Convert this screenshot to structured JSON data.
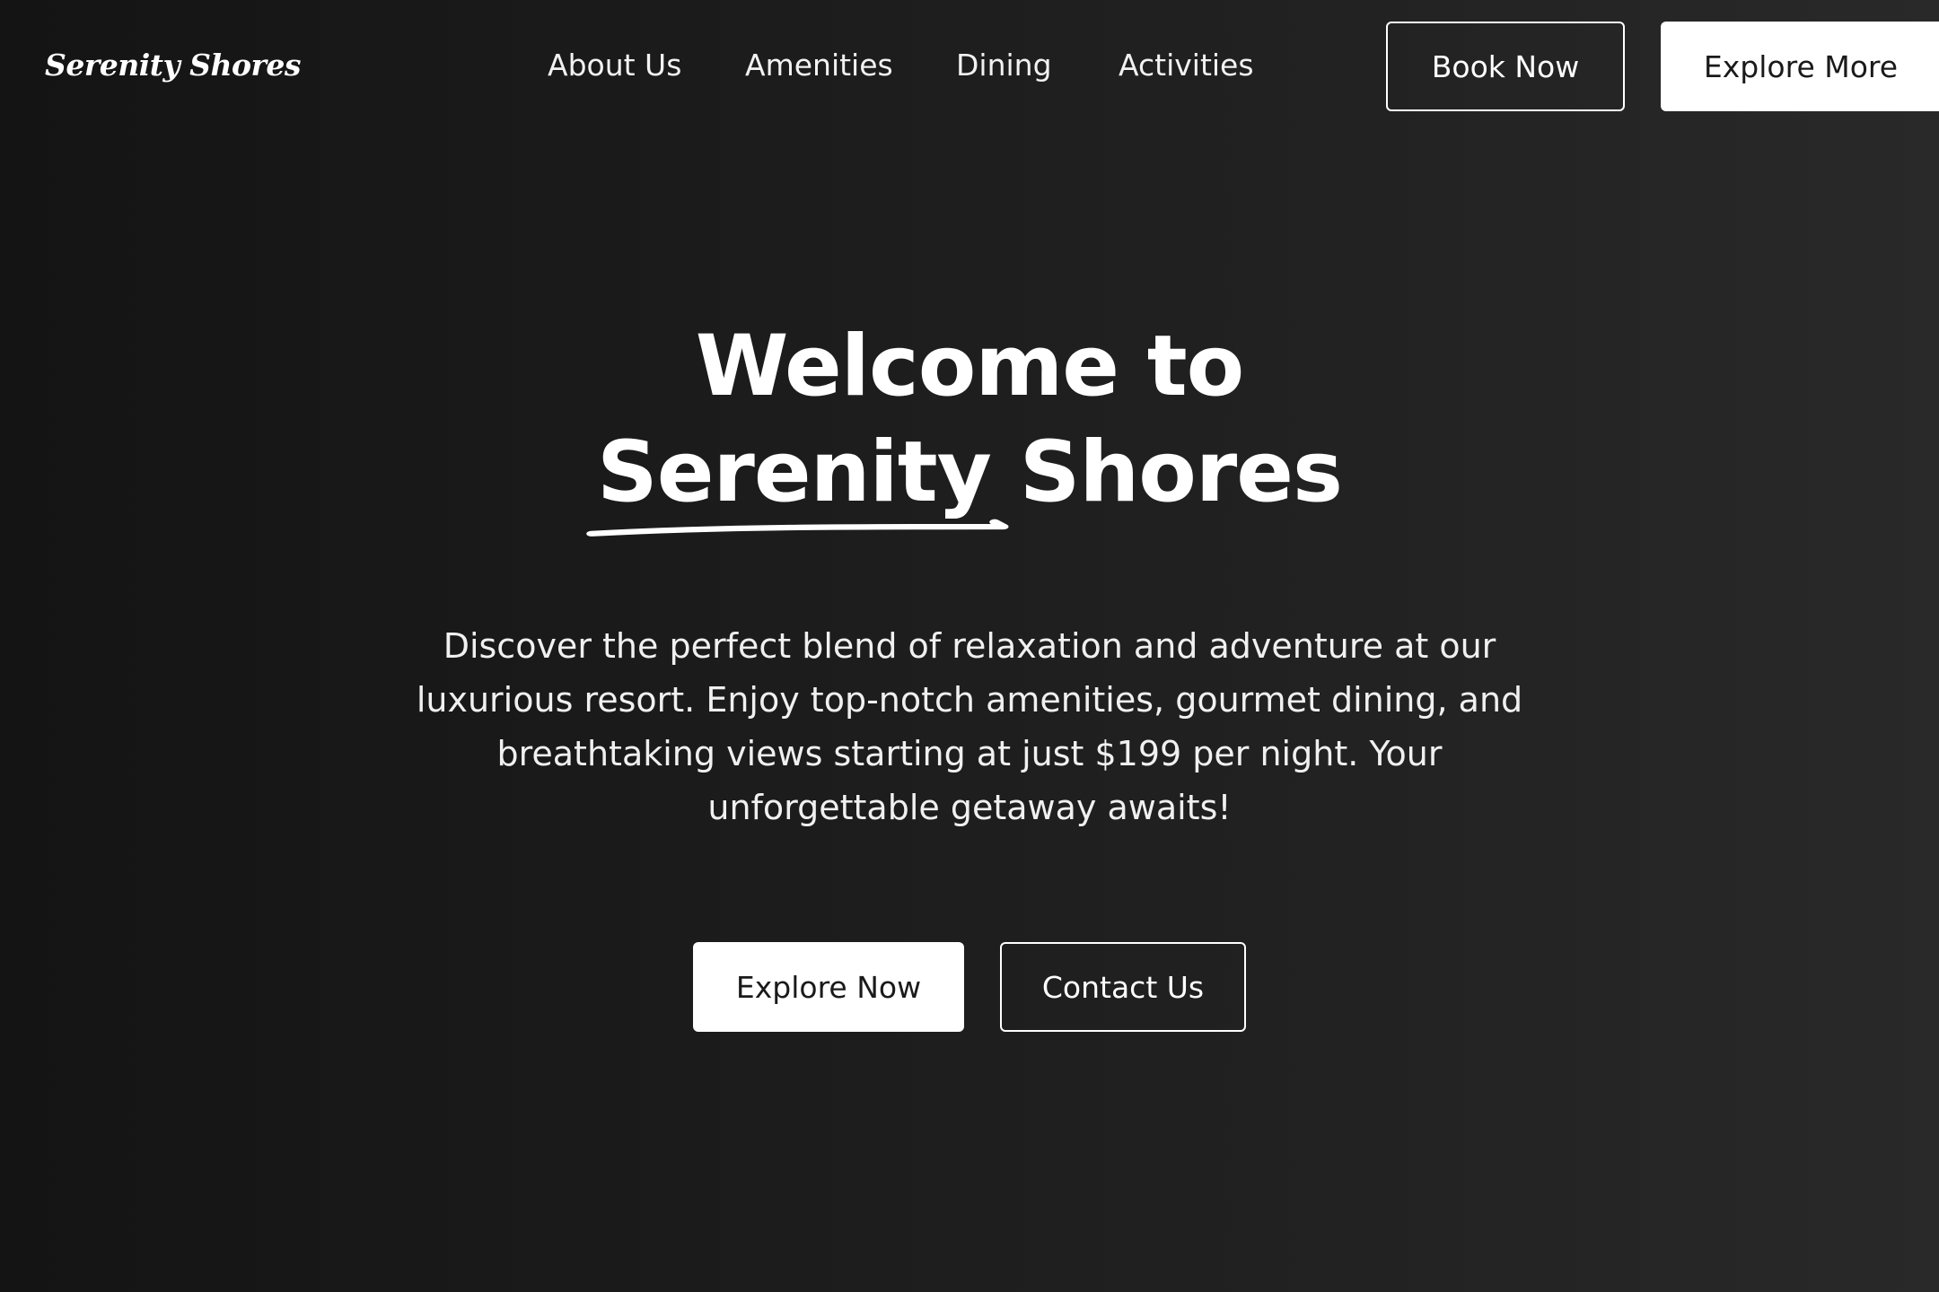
{
  "header": {
    "logo": "Serenity Shores",
    "nav": {
      "about": "About Us",
      "amenities": "Amenities",
      "dining": "Dining",
      "activities": "Activities"
    },
    "book_label": "Book Now",
    "explore_more_label": "Explore More"
  },
  "hero": {
    "title_line1": "Welcome to",
    "title_word_underlined": "Serenity",
    "title_word_rest": "Shores",
    "description": "Discover the perfect blend of relaxation and adventure at our luxurious resort. Enjoy top-notch amenities, gourmet dining, and breathtaking views starting at just $199 per night. Your unforgettable getaway awaits!",
    "primary_cta": "Explore Now",
    "secondary_cta": "Contact Us"
  },
  "colors": {
    "background_dark": "#141414",
    "background_light": "#292929",
    "text": "#ffffff",
    "button_fill": "#ffffff",
    "button_text_dark": "#1a1a1a"
  },
  "icons": {
    "title_underline": "hand-drawn-underline"
  }
}
